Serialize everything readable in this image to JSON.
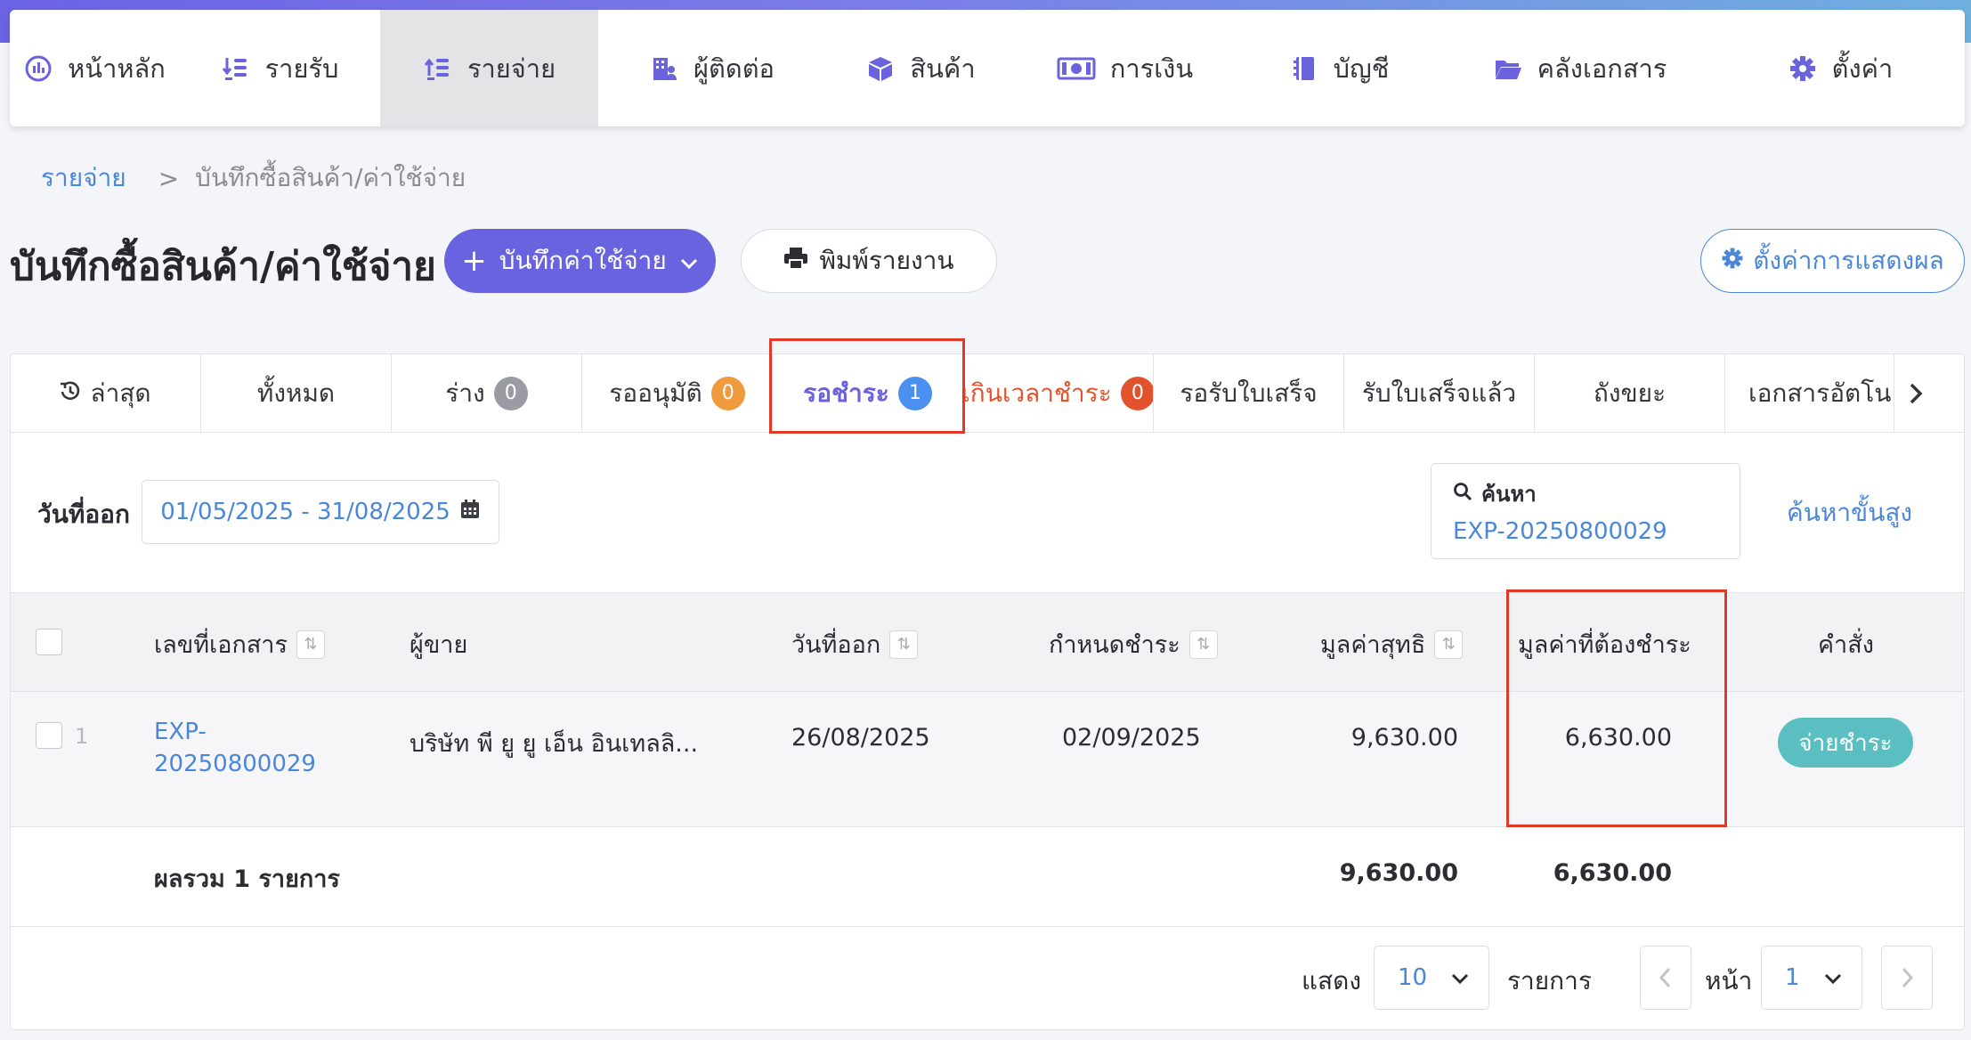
{
  "nav": {
    "items": [
      {
        "label": "หน้าหลัก",
        "icon": "dashboard-icon"
      },
      {
        "label": "รายรับ",
        "icon": "income-list-icon"
      },
      {
        "label": "รายจ่าย",
        "icon": "expense-list-icon"
      },
      {
        "label": "ผู้ติดต่อ",
        "icon": "contacts-building-icon"
      },
      {
        "label": "สินค้า",
        "icon": "product-box-icon"
      },
      {
        "label": "การเงิน",
        "icon": "money-icon"
      },
      {
        "label": "บัญชี",
        "icon": "ledger-book-icon"
      },
      {
        "label": "คลังเอกสาร",
        "icon": "folder-icon"
      },
      {
        "label": "ตั้งค่า",
        "icon": "gear-icon"
      }
    ],
    "active": "รายจ่าย"
  },
  "breadcrumb": {
    "parent": "รายจ่าย",
    "separator": ">",
    "current": "บันทึกซื้อสินค้า/ค่าใช้จ่าย"
  },
  "page": {
    "title": "บันทึกซื้อสินค้า/ค่าใช้จ่าย",
    "add_button": "บันทึกค่าใช้จ่าย",
    "print_button": "พิมพ์รายงาน",
    "display_settings_button": "ตั้งค่าการแสดงผล"
  },
  "tabs": [
    {
      "label": "ล่าสุด",
      "badge": null
    },
    {
      "label": "ทั้งหมด",
      "badge": null
    },
    {
      "label": "ร่าง",
      "badge": "0",
      "badge_color": "#9b9ca3"
    },
    {
      "label": "รออนุมัติ",
      "badge": "0",
      "badge_color": "#ef9a3c"
    },
    {
      "label": "รอชำระ",
      "badge": "1",
      "badge_color": "#4b8ff0",
      "active": true
    },
    {
      "label": "เกินเวลาชำระ",
      "badge": "0",
      "badge_color": "#e2532d"
    },
    {
      "label": "รอรับใบเสร็จ",
      "badge": null
    },
    {
      "label": "รับใบเสร็จแล้ว",
      "badge": null
    },
    {
      "label": "ถังขยะ",
      "badge": null
    },
    {
      "label": "เอกสารอัตโน",
      "badge": null
    }
  ],
  "filters": {
    "date_label": "วันที่ออก",
    "date_range": "01/05/2025 - 31/08/2025",
    "search_label": "ค้นหา",
    "search_value": "EXP-20250800029",
    "advanced_search": "ค้นหาขั้นสูง"
  },
  "table": {
    "headers": {
      "doc_no": "เลขที่เอกสาร",
      "vendor": "ผู้ขาย",
      "issue_date": "วันที่ออก",
      "due_date": "กำหนดชำระ",
      "net_value": "มูลค่าสุทธิ",
      "amount_due": "มูลค่าที่ต้องชำระ",
      "action": "คำสั่ง"
    },
    "rows": [
      {
        "index": "1",
        "doc_no_line1": "EXP-",
        "doc_no_line2": "20250800029",
        "vendor": "บริษัท พี ยู ยู เอ็น อินเทลลิ...",
        "issue_date": "26/08/2025",
        "due_date": "02/09/2025",
        "net_value": "9,630.00",
        "amount_due": "6,630.00",
        "action": "จ่ายชำระ"
      }
    ],
    "footer": {
      "label": "ผลรวม 1 รายการ",
      "net_total": "9,630.00",
      "due_total": "6,630.00"
    }
  },
  "pagination": {
    "show_label": "แสดง",
    "page_size": "10",
    "items_label": "รายการ",
    "page_label": "หน้า",
    "page": "1"
  },
  "colors": {
    "accent": "#6a63e0",
    "link": "#4b87d8",
    "pay_button": "#5bbfc1",
    "highlight": "#e03a27"
  }
}
